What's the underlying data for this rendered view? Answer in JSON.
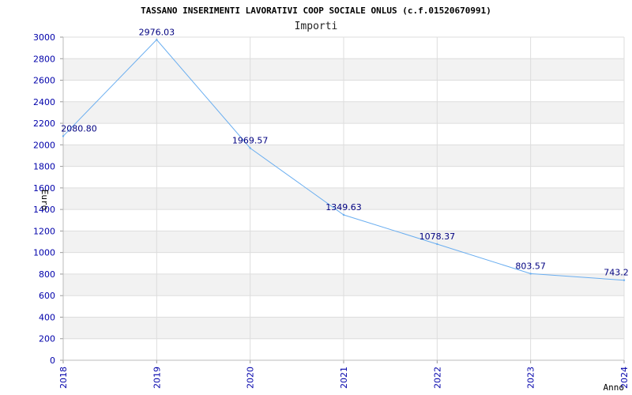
{
  "chart_data": {
    "type": "line",
    "title": "TASSANO INSERIMENTI LAVORATIVI COOP SOCIALE ONLUS (c.f.01520670991)",
    "subtitle": "Importi",
    "xlabel": "Anno",
    "ylabel": "Euro",
    "categories": [
      "2018",
      "2019",
      "2020",
      "2021",
      "2022",
      "2023",
      "2024"
    ],
    "series": [
      {
        "values": [
          2080.8,
          2976.03,
          1969.57,
          1349.63,
          1078.37,
          803.57,
          743.2
        ],
        "labels": [
          "2080.80",
          "2976.03",
          "1969.57",
          "1349.63",
          "1078.37",
          "803.57",
          "743.2"
        ]
      }
    ],
    "ylim": [
      0,
      3000
    ],
    "yticks": [
      0,
      200,
      400,
      600,
      800,
      1000,
      1200,
      1400,
      1600,
      1800,
      2000,
      2200,
      2400,
      2600,
      2800,
      3000
    ],
    "grid": true,
    "colors": {
      "line": "#6aaef0",
      "band": "#f2f2f2",
      "grid": "#dddddd",
      "tick": "#0000aa",
      "data_label": "#000080"
    }
  }
}
